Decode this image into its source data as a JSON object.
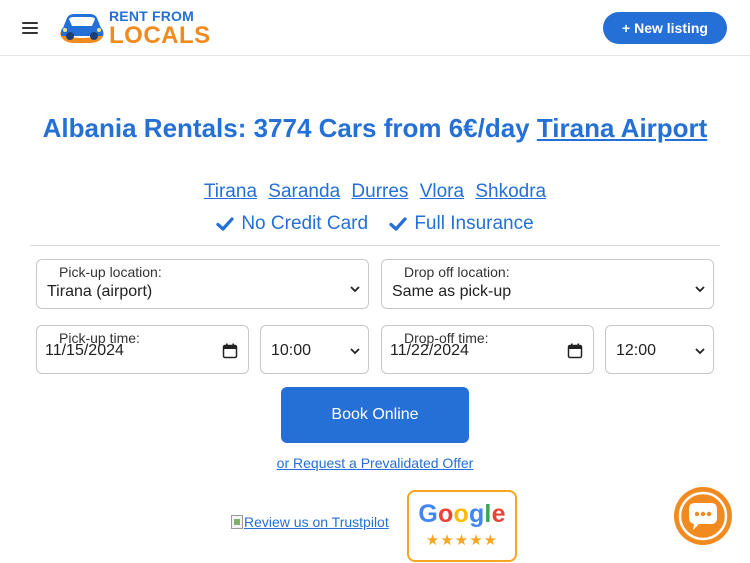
{
  "header": {
    "logo_line1": "RENT FROM",
    "logo_line2": "LOCALS",
    "new_listing_label": "+ New listing"
  },
  "hero": {
    "title_text": "Albania Rentals: 3774 Cars from 6€/day ",
    "title_link": "Tirana Airport",
    "cities": [
      "Tirana",
      "Saranda",
      "Durres",
      "Vlora",
      "Shkodra"
    ],
    "features": [
      "No Credit Card",
      "Full Insurance"
    ]
  },
  "form": {
    "pickup_location": {
      "label": "Pick-up location:",
      "value": "Tirana (airport)"
    },
    "dropoff_location": {
      "label": "Drop off location:",
      "value": "Same as pick-up"
    },
    "pickup_time": {
      "label": "Pick-up time:",
      "date": "11/15/2024",
      "time": "10:00"
    },
    "dropoff_time": {
      "label": "Drop-off time:",
      "date": "11/22/2024",
      "time": "12:00"
    },
    "book_label": "Book Online",
    "offer_link": "or Request a Prevalidated Offer"
  },
  "reviews": {
    "trustpilot_alt": "Review us on Trustpilot",
    "google_word": [
      "G",
      "o",
      "o",
      "g",
      "l",
      "e"
    ],
    "google_stars": "★★★★★"
  },
  "colors": {
    "brand_blue": "#2470d6",
    "brand_orange": "#f28b1f",
    "badge_border": "#f5a623"
  },
  "icons": [
    "menu-icon",
    "car-logo-icon",
    "check-icon",
    "chevron-down-icon",
    "calendar-icon",
    "chat-icon"
  ]
}
